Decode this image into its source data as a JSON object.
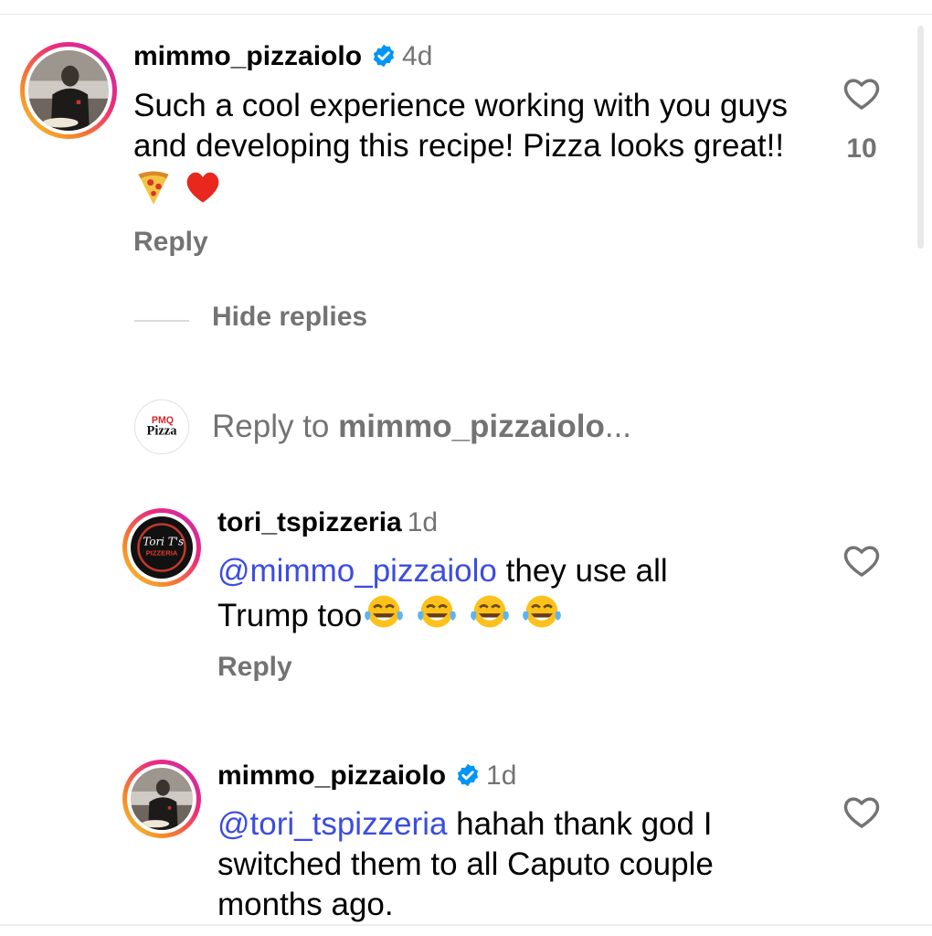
{
  "comments": [
    {
      "username": "mimmo_pizzaiolo",
      "verified": true,
      "time": "4d",
      "text": "Such a cool experience working with you guys and developing this recipe! Pizza looks great!!",
      "emojis": [
        "pizza-slice",
        "red-heart"
      ],
      "reply_label": "Reply",
      "likes": "10"
    }
  ],
  "hide_replies_label": "Hide replies",
  "reply_box": {
    "prefix": "Reply to ",
    "target": "mimmo_pizzaiolo",
    "suffix": "..."
  },
  "replies": [
    {
      "username": "tori_tspizzeria",
      "verified": false,
      "time": "1d",
      "mention": "@mimmo_pizzaiolo",
      "text_line1": " they use all",
      "text_line2": "Trump too",
      "emojis": [
        "tears-of-joy",
        "tears-of-joy",
        "tears-of-joy",
        "tears-of-joy"
      ],
      "reply_label": "Reply"
    },
    {
      "username": "mimmo_pizzaiolo",
      "verified": true,
      "time": "1d",
      "mention": "@tori_tspizzeria",
      "text_line1": " hahah thank god I",
      "text_line2": "switched them to all Caputo couple",
      "text_line3": "months ago."
    }
  ],
  "colors": {
    "mention": "#3b4de0",
    "secondary_text": "#737373",
    "verified": "#0095f6"
  },
  "avatar_texts": {
    "pmq_logo_top": "PMQ",
    "pmq_logo_bottom": "Pizza",
    "tori_logo_line1": "Tori T's",
    "tori_logo_line2": "PIZZERIA"
  }
}
